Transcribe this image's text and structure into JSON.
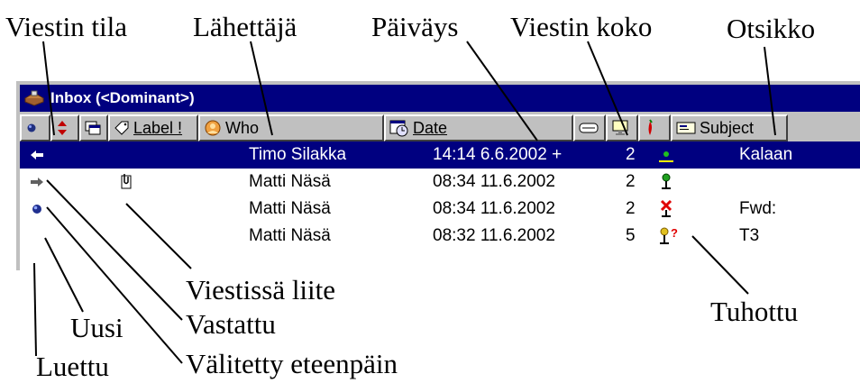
{
  "callouts": {
    "viestin_tila": "Viestin tila",
    "lahettaja": "Lähettäjä",
    "paivays": "Päiväys",
    "viestin_koko": "Viestin koko",
    "otsikko": "Otsikko",
    "viestissa_liite": "Viestissä liite",
    "uusi": "Uusi",
    "vastattu": "Vastattu",
    "tuhottu": "Tuhottu",
    "luettu": "Luettu",
    "valitetty": "Välitetty eteenpäin"
  },
  "window": {
    "title": "Inbox (<Dominant>)"
  },
  "columns": {
    "label": "Label !",
    "who": "Who",
    "date": "Date",
    "subject": "Subject"
  },
  "messages": [
    {
      "who": "Timo Silakka",
      "date": "14:14 6.6.2002 +",
      "size": "2",
      "subject": "Kalaan",
      "status_icon": "replied-arrow-icon",
      "selected": true
    },
    {
      "who": "Matti Näsä",
      "date": "08:34 11.6.2002",
      "size": "2",
      "subject": "",
      "status_icon": "forwarded-arrow-icon",
      "attachment": true
    },
    {
      "who": "Matti Näsä",
      "date": "08:34 11.6.2002",
      "size": "2",
      "subject": "Fwd:",
      "status_icon": "new-dot-icon",
      "deleted": true
    },
    {
      "who": "Matti Näsä",
      "date": "08:32 11.6.2002",
      "size": "5",
      "subject": "T3",
      "status_icon": "read-none"
    }
  ],
  "colors": {
    "titlebar": "#000080",
    "selection": "#000080",
    "face": "#c0c0c0"
  }
}
